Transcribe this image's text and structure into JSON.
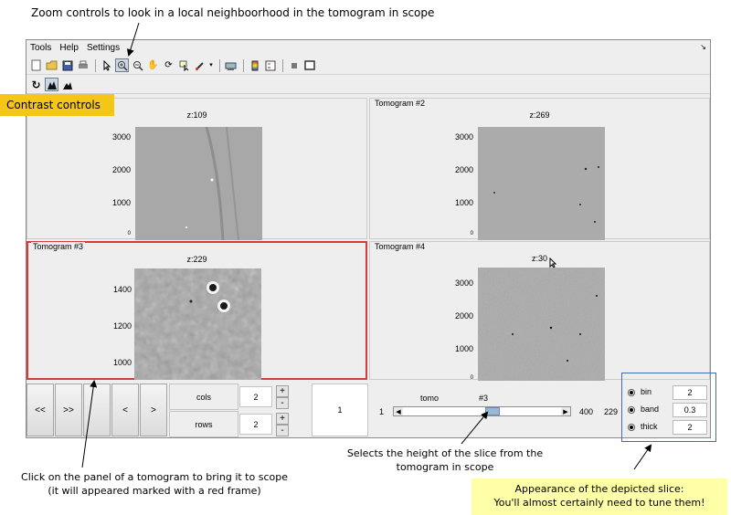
{
  "annotations": {
    "zoom": "Zoom controls to look in a local neighboorhood in  the tomogram in scope",
    "contrast": "Contrast controls",
    "panel_line1": "Click on the panel of a tomogram to bring it to scope",
    "panel_line2": "(it will appeared marked with a red frame)",
    "slice_line1": "Selects the height of the slice from the",
    "slice_line2": "tomogram in scope",
    "appearance_line1": "Appearance of the depicted slice:",
    "appearance_line2": "You'll almost certainly need to tune them!"
  },
  "menu": {
    "tools": "Tools",
    "help": "Help",
    "settings": "Settings"
  },
  "panels": [
    {
      "title": "",
      "z": "z:109",
      "ticks": [
        "3000",
        "2000",
        "1000",
        "0"
      ]
    },
    {
      "title": "Tomogram #2",
      "z": "z:269",
      "ticks": [
        "3000",
        "2000",
        "1000",
        "0"
      ]
    },
    {
      "title": "Tomogram #3",
      "z": "z:229",
      "ticks": [
        "1400",
        "1200",
        "1000"
      ]
    },
    {
      "title": "Tomogram #4",
      "z": "z:30",
      "ticks": [
        "3000",
        "2000",
        "1000",
        "0"
      ]
    }
  ],
  "nav": {
    "first": "<<",
    "last": ">>",
    "prev": "<",
    "next": ">",
    "cols_label": "cols",
    "cols_value": "2",
    "rows_label": "rows",
    "rows_value": "2",
    "plus": "+",
    "minus": "-",
    "page": "1"
  },
  "slider": {
    "label": "tomo",
    "current": "#3",
    "min": "1",
    "max": "400",
    "value": "229",
    "position": 0.573
  },
  "params": [
    {
      "label": "bin",
      "value": "2"
    },
    {
      "label": "band",
      "value": "0.3"
    },
    {
      "label": "thick",
      "value": "2"
    }
  ],
  "icons": {
    "toolbar": [
      "new-file-icon",
      "open-folder-icon",
      "save-icon",
      "print-icon",
      "pointer-icon",
      "zoom-in-icon",
      "zoom-out-icon",
      "pan-icon",
      "rotate-3d-icon",
      "data-cursor-icon",
      "brush-icon",
      "link-icon",
      "colorbar-icon",
      "legend-icon",
      "hide-plot-icon",
      "show-plot-icon"
    ],
    "contrast": [
      "refresh-icon",
      "contrast-auto-icon",
      "contrast-manual-icon"
    ]
  },
  "colors": {
    "selected_frame": "#d43c3c",
    "contrast_label_bg": "#f5c518",
    "note_bg": "#ffffa8",
    "param_frame": "#3f6db5"
  }
}
